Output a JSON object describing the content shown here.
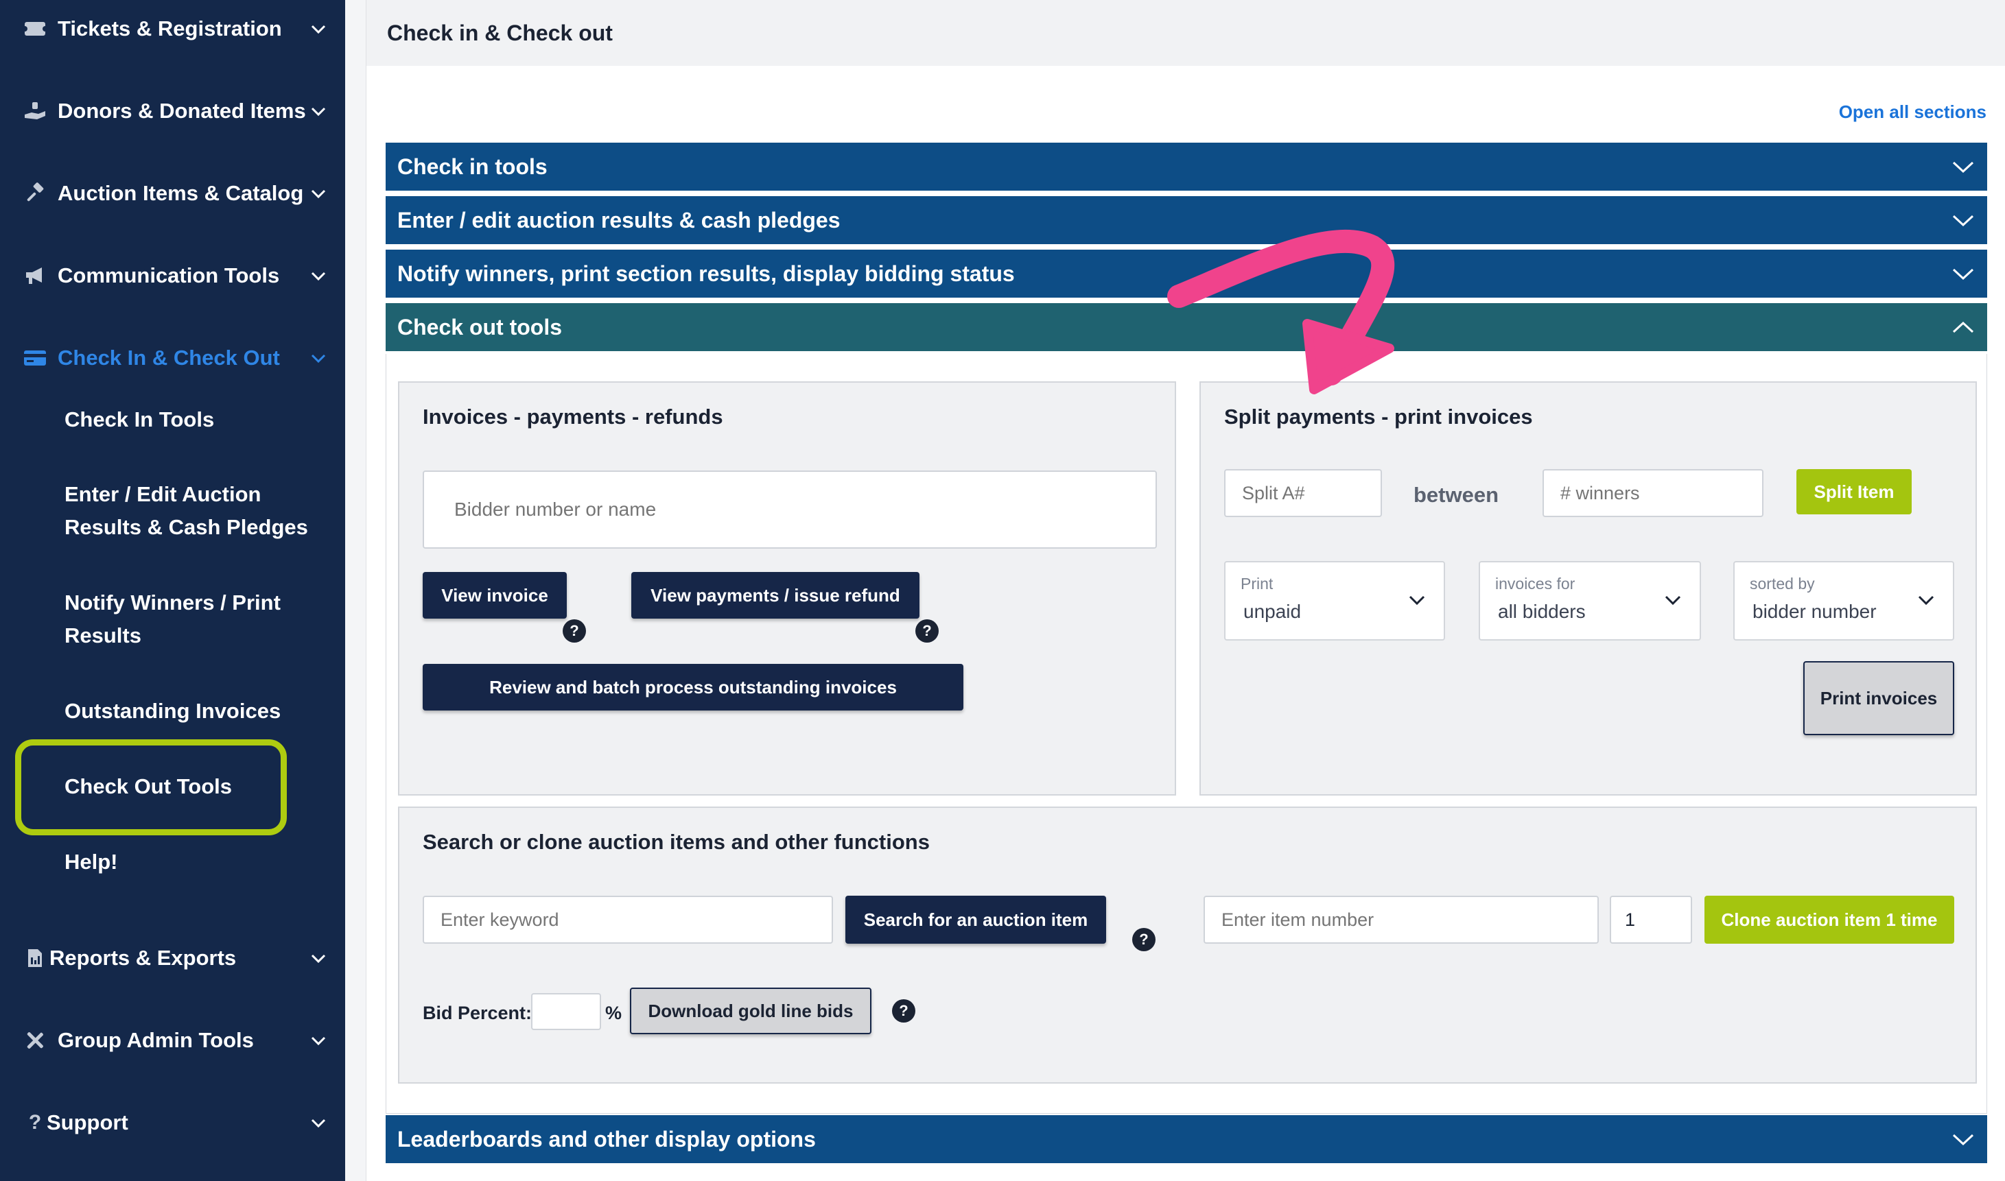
{
  "sidebar": {
    "items": [
      {
        "label": "Tickets & Registration",
        "icon": "ticket-icon"
      },
      {
        "label": "Donors & Donated Items",
        "icon": "donate-hand-icon"
      },
      {
        "label": "Auction Items & Catalog",
        "icon": "gavel-icon"
      },
      {
        "label": "Communication Tools",
        "icon": "megaphone-icon"
      },
      {
        "label": "Check In & Check Out",
        "icon": "credit-card-icon"
      },
      {
        "label": "Reports & Exports",
        "icon": "document-icon"
      },
      {
        "label": "Group Admin Tools",
        "icon": "tools-icon"
      },
      {
        "label": "Support",
        "icon": "question-icon"
      }
    ],
    "subitems": [
      {
        "label": "Check In Tools"
      },
      {
        "label": "Enter / Edit Auction Results & Cash Pledges"
      },
      {
        "label": "Notify Winners / Print Results"
      },
      {
        "label": "Outstanding Invoices"
      },
      {
        "label": "Check Out Tools"
      },
      {
        "label": "Help!"
      }
    ]
  },
  "header": {
    "title": "Check in & Check out"
  },
  "open_all": "Open all sections",
  "sections": [
    {
      "label": "Check in tools"
    },
    {
      "label": "Enter / edit auction results & cash pledges"
    },
    {
      "label": "Notify winners, print section results, display bidding status"
    },
    {
      "label": "Check out tools"
    },
    {
      "label": "Leaderboards and other display options"
    }
  ],
  "invoices_panel": {
    "title": "Invoices - payments - refunds",
    "bidder_placeholder": "Bidder number or name",
    "view_invoice": "View invoice",
    "view_payments": "View payments / issue refund",
    "review_batch": "Review and batch process outstanding invoices"
  },
  "split_panel": {
    "title": "Split payments - print invoices",
    "split_placeholder": "Split A#",
    "between": "between",
    "winners_placeholder": "# winners",
    "split_button": "Split Item",
    "selects": [
      {
        "label": "Print",
        "value": "unpaid"
      },
      {
        "label": "invoices for",
        "value": "all bidders"
      },
      {
        "label": "sorted by",
        "value": "bidder number"
      }
    ],
    "print_button": "Print invoices"
  },
  "search_panel": {
    "title": "Search or clone auction items and other functions",
    "keyword_placeholder": "Enter keyword",
    "search_button": "Search for an auction item",
    "item_placeholder": "Enter item number",
    "clone_count": "1",
    "clone_button": "Clone auction item 1 time",
    "bid_percent_label": "Bid Percent:",
    "percent_sign": "%",
    "download_button": "Download gold line bids"
  },
  "help_glyph": "?",
  "colors": {
    "sidebar_bg": "#14284a",
    "active_blue": "#2f86e6",
    "section_blue": "#0d4d86",
    "section_teal": "#1f6270",
    "accent_green": "#a4c50f",
    "highlight_green": "#aecc10",
    "arrow_pink": "#f0438c",
    "dark_button": "#162648"
  }
}
